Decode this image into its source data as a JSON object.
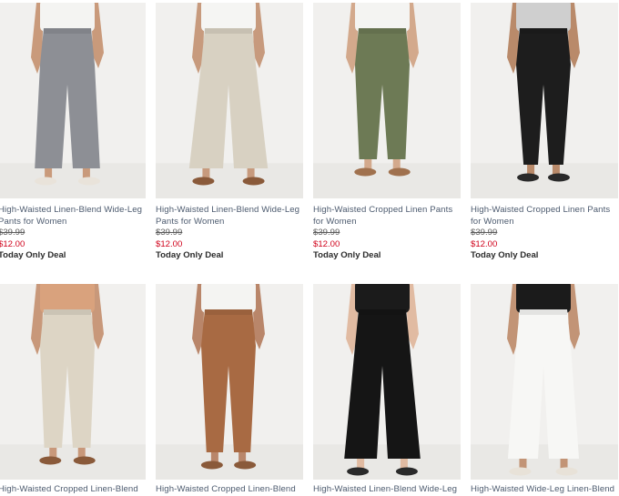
{
  "products": [
    {
      "title": "High-Waisted Linen-Blend Wide-Leg Pants for Women",
      "original_price": "$39.99",
      "sale_price": "$12.00",
      "deal": "Today Only Deal",
      "pant_color": "#8d8f95",
      "top_color": "#f4f4f2",
      "shoe_color": "#e9e3da",
      "skin_color": "#c99a7b"
    },
    {
      "title": "High-Waisted Linen-Blend Wide-Leg Pants for Women",
      "original_price": "$39.99",
      "sale_price": "$12.00",
      "deal": "Today Only Deal",
      "pant_color": "#d8d1c2",
      "top_color": "#f5f5f3",
      "shoe_color": "#8a5a3a",
      "skin_color": "#c79a7d"
    },
    {
      "title": "High-Waisted Cropped Linen Pants for Women",
      "original_price": "$39.99",
      "sale_price": "$12.00",
      "deal": "Today Only Deal",
      "pant_color": "#6d7a55",
      "top_color": "#f4f4f2",
      "shoe_color": "#a0714e",
      "skin_color": "#d3a98c"
    },
    {
      "title": "High-Waisted Cropped Linen Pants for Women",
      "original_price": "$39.99",
      "sale_price": "$12.00",
      "deal": "Today Only Deal",
      "pant_color": "#1d1d1d",
      "top_color": "#cfcfcf",
      "shoe_color": "#2a2a2a",
      "skin_color": "#b98a6a"
    },
    {
      "title": "High-Waisted Cropped Linen-Blend",
      "pant_color": "#ddd5c5",
      "top_color": "#d9a27d",
      "shoe_color": "#8a5a3a",
      "skin_color": "#c8987a"
    },
    {
      "title": "High-Waisted Cropped Linen-Blend",
      "pant_color": "#a86a43",
      "top_color": "#f4f4f2",
      "shoe_color": "#8a5a3a",
      "skin_color": "#b9866a"
    },
    {
      "title": "High-Waisted Linen-Blend Wide-Leg",
      "pant_color": "#151515",
      "top_color": "#1b1b1b",
      "shoe_color": "#2a2a2a",
      "skin_color": "#e1bba2"
    },
    {
      "title": "High-Waisted Wide-Leg Linen-Blend",
      "pant_color": "#f7f7f5",
      "top_color": "#1b1b1b",
      "shoe_color": "#e8e2d8",
      "skin_color": "#c29476"
    }
  ]
}
